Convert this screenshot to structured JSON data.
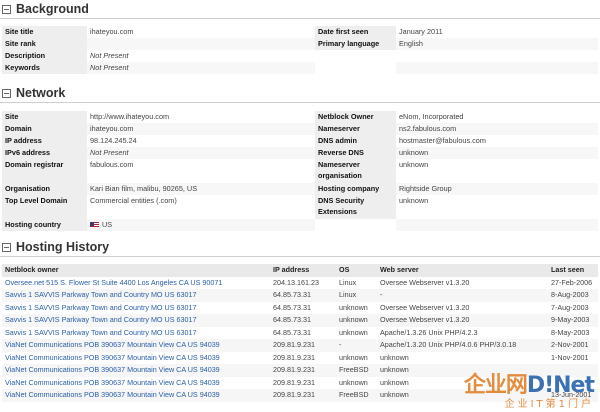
{
  "background": {
    "title": "Background",
    "rows": [
      {
        "k1": "Site title",
        "v1": "ihateyou.com",
        "k2": "Date first seen",
        "v2": "January 2011"
      },
      {
        "k1": "Site rank",
        "v1": "",
        "k2": "Primary language",
        "v2": "English"
      },
      {
        "k1": "Description",
        "v1": "Not Present",
        "k2": "",
        "v2": ""
      },
      {
        "k1": "Keywords",
        "v1": "Not Present",
        "k2": "",
        "v2": ""
      }
    ]
  },
  "network": {
    "title": "Network",
    "rows": [
      {
        "k1": "Site",
        "v1": "http://www.ihateyou.com",
        "k2": "Netblock Owner",
        "v2": "eNom, Incorporated"
      },
      {
        "k1": "Domain",
        "v1": "ihateyou.com",
        "k2": "Nameserver",
        "v2": "ns2.fabulous.com"
      },
      {
        "k1": "IP address",
        "v1": "98.124.245.24",
        "k2": "DNS admin",
        "v2": "hostmaster@fabulous.com"
      },
      {
        "k1": "IPv6 address",
        "v1": "Not Present",
        "k2": "Reverse DNS",
        "v2": "unknown"
      },
      {
        "k1": "Domain registrar",
        "v1": "fabulous.com",
        "k2": "Nameserver organisation",
        "v2": "unknown"
      },
      {
        "k1": "Organisation",
        "v1": "Kari Bian film, malibu, 90265, US",
        "k2": "Hosting company",
        "v2": "Rightside Group"
      },
      {
        "k1": "Top Level Domain",
        "v1": "Commercial entities (.com)",
        "k2": "DNS Security Extensions",
        "v2": "unknown"
      },
      {
        "k1": "Hosting country",
        "v1": "US",
        "k2": "",
        "v2": ""
      }
    ]
  },
  "history": {
    "title": "Hosting History",
    "columns": [
      "Netblock owner",
      "IP address",
      "OS",
      "Web server",
      "Last seen"
    ],
    "rows": [
      [
        "Oversee.net 515 S. Flower St Suite 4400 Los Angeles CA US 90071",
        "204.13.161.23",
        "Linux",
        "Oversee Webserver v1.3.20",
        "27-Feb-2006"
      ],
      [
        "Savvis 1 SAVVIS Parkway Town and Country MO US 63017",
        "64.85.73.31",
        "Linux",
        "-",
        "8-Aug-2003"
      ],
      [
        "Savvis 1 SAVVIS Parkway Town and Country MO US 63017",
        "64.85.73.31",
        "unknown",
        "Oversee Webserver v1.3.20",
        "7-Aug-2003"
      ],
      [
        "Savvis 1 SAVVIS Parkway Town and Country MO US 63017",
        "64.85.73.31",
        "unknown",
        "Oversee Webserver v1.3.20",
        "9-May-2003"
      ],
      [
        "Savvis 1 SAVVIS Parkway Town and Country MO US 63017",
        "64.85.73.31",
        "unknown",
        "Apache/1.3.26 Unix PHP/4.2.3",
        "8-May-2003"
      ],
      [
        "ViaNet Communications POB 390637 Mountain View CA US 94039",
        "209.81.9.231",
        "-",
        "Apache/1.3.20 Unix PHP/4.0.6 PHP/3.0.18",
        "2-Nov-2001"
      ],
      [
        "ViaNet Communications POB 390637 Mountain View CA US 94039",
        "209.81.9.231",
        "unknown",
        "unknown",
        "1-Nov-2001"
      ],
      [
        "ViaNet Communications POB 390637 Mountain View CA US 94039",
        "209.81.9.231",
        "FreeBSD",
        "unknown",
        ""
      ],
      [
        "ViaNet Communications POB 390637 Mountain View CA US 94039",
        "209.81.9.231",
        "unknown",
        "unknown",
        ""
      ],
      [
        "ViaNet Communications POB 390637 Mountain View CA US 94039",
        "209.81.9.231",
        "FreeBSD",
        "unknown",
        "13-Jun-2001"
      ]
    ]
  },
  "watermark": {
    "top_orange": "企业网",
    "top_blue": "D",
    "top_tail": "!Net",
    "bottom": "企业IT第1门户"
  },
  "colors": {
    "link": "#2a5ea8",
    "header_bg": "#eeeeee",
    "watermark_orange": "#e07a1f",
    "watermark_blue": "#1a5aa8"
  }
}
